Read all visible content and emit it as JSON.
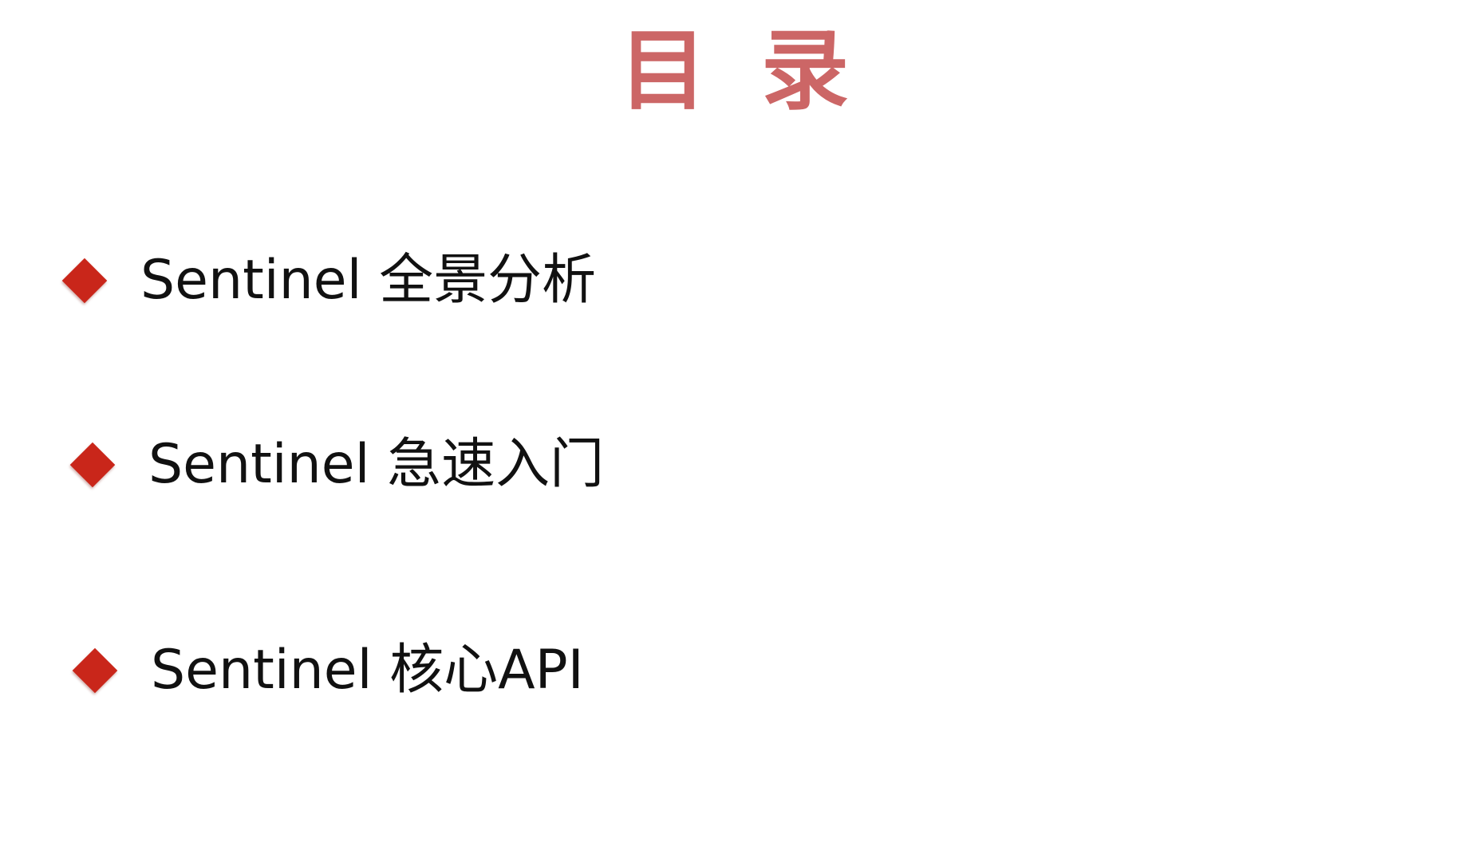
{
  "slide": {
    "title": "目录",
    "items": [
      {
        "label": "Sentinel 全景分析"
      },
      {
        "label": "Sentinel 急速入门"
      },
      {
        "label": "Sentinel 核心API"
      }
    ]
  },
  "colors": {
    "title": "#cc6666",
    "bullet": "#c9261a",
    "text": "#111111",
    "background": "#ffffff"
  },
  "icons": {
    "bullet": "diamond-bullet-icon"
  }
}
